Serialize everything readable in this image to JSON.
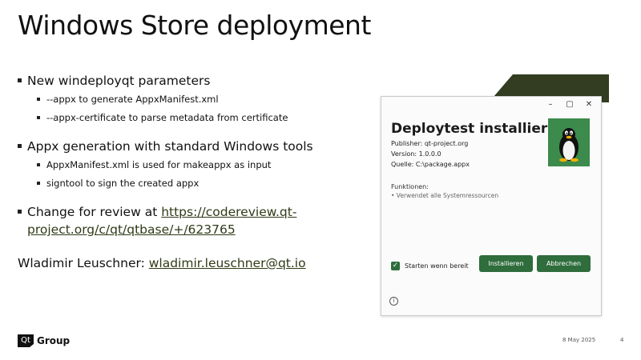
{
  "slide": {
    "title": "Windows Store deployment",
    "bullets": [
      {
        "text": "New windeployqt parameters",
        "sub": [
          "--appx to generate AppxManifest.xml",
          "--appx-certificate to parse metadata from certificate"
        ]
      },
      {
        "text": "Appx generation with standard Windows tools",
        "sub": [
          "AppxManifest.xml is used for makeappx as input",
          "signtool to sign the created appx"
        ]
      }
    ],
    "review": {
      "prefix": "Change for review at ",
      "link": "https://codereview.qt-project.org/c/qt/qtbase/+/623765"
    },
    "author": {
      "name": "Wladimir Leuschner: ",
      "email": "wladimir.leuschner@qt.io"
    },
    "accent_color": "#323d22"
  },
  "dialog": {
    "minimize": "–",
    "maximize": "▢",
    "close": "✕",
    "title": "Deploytest installieren?",
    "publisher": "Publisher: qt-project.org",
    "version": "Version: 1.0.0.0",
    "source": "Quelle: C:\\package.appx",
    "features_heading": "Funktionen:",
    "features_item": "• Verwendet alle Systemressourcen",
    "checkbox_label": "Starten wenn bereit",
    "checkbox_checked": true,
    "install_button": "Installieren",
    "cancel_button": "Abbrechen",
    "info_icon": "i",
    "button_color": "#2f6d3c",
    "logo_bg_color": "#3c8a4c"
  },
  "footer": {
    "logo_mark": "Qt",
    "logo_text": "Group",
    "date": "8 May 2025",
    "page": "4"
  }
}
